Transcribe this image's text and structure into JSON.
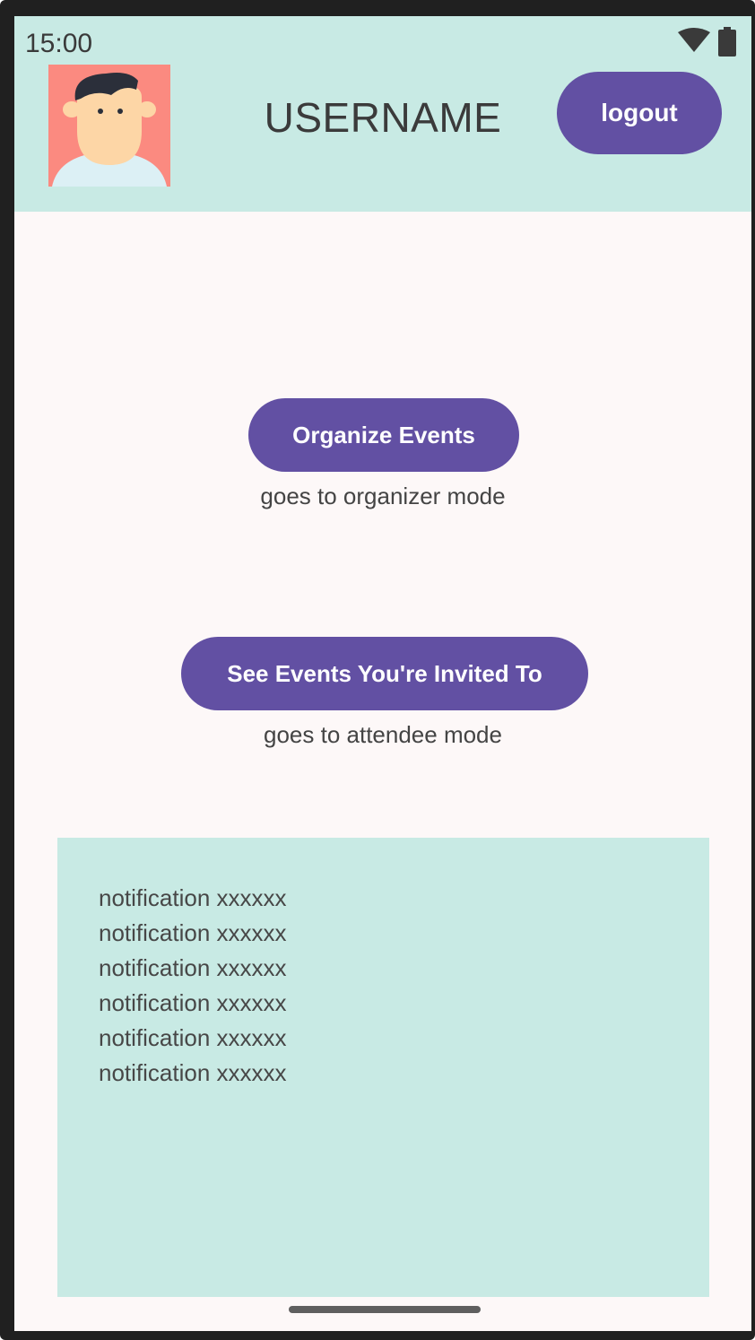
{
  "status_bar": {
    "time": "15:00",
    "icons": [
      "wifi-icon",
      "battery-icon"
    ]
  },
  "header": {
    "avatar": "avatar-icon",
    "username": "USERNAME",
    "logout_label": "logout"
  },
  "main": {
    "organize_label": "Organize Events",
    "organize_caption": "goes to organizer mode",
    "invited_label": "See Events You're Invited To",
    "invited_caption": "goes to attendee mode"
  },
  "notifications": [
    "notification xxxxxx",
    "notification xxxxxx",
    "notification xxxxxx",
    "notification xxxxxx",
    "notification xxxxxx",
    "notification xxxxxx"
  ],
  "colors": {
    "header_bg": "#c8eae4",
    "accent": "#6250a3",
    "avatar_bg": "#fb8a80",
    "screen_bg": "#fdf8f8"
  }
}
